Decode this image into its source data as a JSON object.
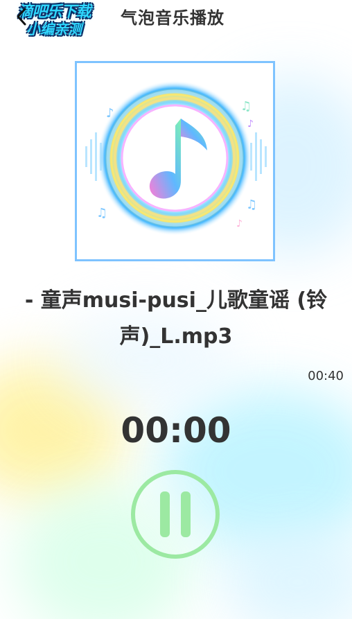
{
  "header": {
    "title": "气泡音乐播放",
    "back_icon": "chevron-left-icon",
    "watermark_line1": "滴吧乐下载",
    "watermark_line2": "小编亲测"
  },
  "player": {
    "cover_icon": "music-note-icon",
    "song_title": "- 童声musi-pusi_儿歌童谣 (铃声)_L.mp3",
    "duration": "00:40",
    "elapsed": "00:00",
    "state_icon": "pause-icon"
  },
  "colors": {
    "accent_green": "#9ce9a2",
    "cover_border": "#7ec3ff",
    "text": "#333333",
    "watermark": "#2fd8ff"
  }
}
